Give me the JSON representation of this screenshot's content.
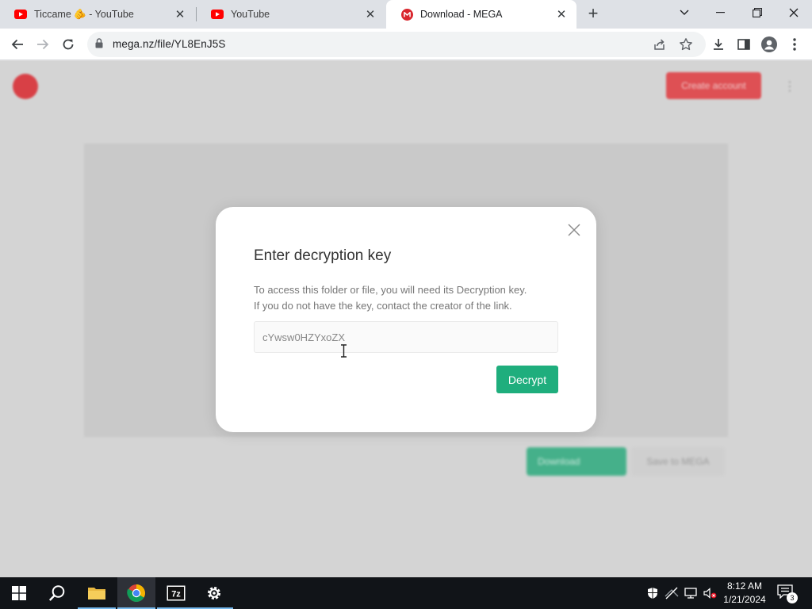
{
  "browser": {
    "tabs": [
      {
        "title": "Ticcame 🫵 - YouTube",
        "favicon": "youtube-icon",
        "active": false
      },
      {
        "title": "YouTube",
        "favicon": "youtube-icon",
        "active": false
      },
      {
        "title": "Download - MEGA",
        "favicon": "mega-icon",
        "active": true
      }
    ],
    "url": "mega.nz/file/YL8EnJ5S"
  },
  "page": {
    "header": {
      "create_account_label": "Create account"
    },
    "download_label": "Download",
    "save_label": "Save to MEGA"
  },
  "modal": {
    "title": "Enter decryption key",
    "description_line1": "To access this folder or file, you will need its Decryption key.",
    "description_line2": "If you do not have the key, contact the creator of the link.",
    "key_value": "cYwsw0HZYxoZX",
    "decrypt_label": "Decrypt"
  },
  "taskbar": {
    "time": "8:12 AM",
    "date": "1/21/2024",
    "notification_count": "3",
    "apps": [
      "start-icon",
      "search-icon",
      "file-explorer-icon",
      "chrome-icon",
      "7zip-icon",
      "settings-icon"
    ]
  },
  "colors": {
    "mega_red": "#d9272e",
    "decrypt_green": "#1fae7d",
    "youtube_red": "#ff0000"
  }
}
